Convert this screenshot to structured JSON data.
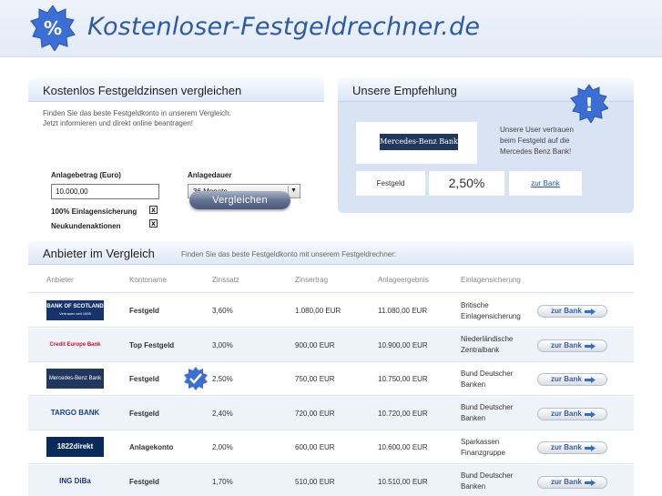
{
  "header": {
    "site_title": "Kostenloser-Festgeldrechner.de",
    "logo_symbol": "%",
    "logo_icon": "percent-badge-icon"
  },
  "compare": {
    "title": "Kostenlos Festgeldzinsen vergleichen",
    "description_line1": "Finden Sie das beste Festgeldkonto in unserem Vergleich.",
    "description_line2": "Jetzt informieren und direkt online beantragen!",
    "amount_label": "Anlagebetrag (Euro)",
    "amount_value": "10.000,00",
    "duration_label": "Anlagedauer",
    "duration_value": "36 Monate",
    "check1_label": "100% Einlagensicherung",
    "check1_mark": "x",
    "check2_label": "Neukundenaktionen",
    "check2_mark": "x",
    "button_label": "Vergleichen"
  },
  "recommendation": {
    "title": "Unsere Empfehlung",
    "badge_symbol": "!",
    "bank_logo_text": "Mercedes-Benz Bank",
    "text": "Unsere User vertrauen beim Festgeld auf die Mercedes Benz Bank!",
    "product": "Festgeld",
    "rate": "2,50%",
    "link_label": "zur Bank"
  },
  "offers": {
    "title": "Anbieter im Vergleich",
    "subtitle": "Finden Sie das beste Festgeldkonto mit unserem Festgeldrechner:",
    "columns": [
      "Anbieter",
      "Kontoname",
      "Zinssatz",
      "Zinsertrag",
      "Anlageergebnis",
      "Einlagensicherung"
    ],
    "button_label": "zur Bank",
    "rows": [
      {
        "bank_logo": "BANK OF SCOTLAND",
        "bank_sub": "Vertrauen seit 1695",
        "account": "Festgeld",
        "rate": "3,60%",
        "interest": "1.080,00 EUR",
        "result": "11.080,00 EUR",
        "deposit_line1": "Britische",
        "deposit_line2": "Einlagensicherung"
      },
      {
        "bank_logo": "Credit Europe Bank",
        "bank_sub": "",
        "account": "Top Festgeld",
        "rate": "3,00%",
        "interest": "900,00 EUR",
        "result": "10.900,00 EUR",
        "deposit_line1": "Niederländische",
        "deposit_line2": "Zentralbank"
      },
      {
        "bank_logo": "Mercedes-Benz Bank",
        "bank_sub": "",
        "account": "Festgeld",
        "rate": "2,50%",
        "interest": "750,00 EUR",
        "result": "10.750,00 EUR",
        "deposit_line1": "Bund Deutscher",
        "deposit_line2": "Banken"
      },
      {
        "bank_logo": "TARGO BANK",
        "bank_sub": "",
        "account": "Festgeld",
        "rate": "2,40%",
        "interest": "720,00 EUR",
        "result": "10.720,00 EUR",
        "deposit_line1": "Bund Deutscher",
        "deposit_line2": "Banken"
      },
      {
        "bank_logo": "1822direkt",
        "bank_sub": "",
        "account": "Anlagekonto",
        "rate": "2,00%",
        "interest": "600,00 EUR",
        "result": "10.600,00 EUR",
        "deposit_line1": "Sparkassen",
        "deposit_line2": "Finanzgruppe"
      },
      {
        "bank_logo": "ING DiBa",
        "bank_sub": "",
        "account": "Festgeld",
        "rate": "1,70%",
        "interest": "510,00 EUR",
        "result": "10.510,00 EUR",
        "deposit_line1": "Bund Deutscher",
        "deposit_line2": "Banken"
      }
    ]
  },
  "colors": {
    "brand_blue": "#2d5aa8",
    "badge_blue": "#3b6fd6",
    "panel_bg": "#d8e3f3"
  }
}
